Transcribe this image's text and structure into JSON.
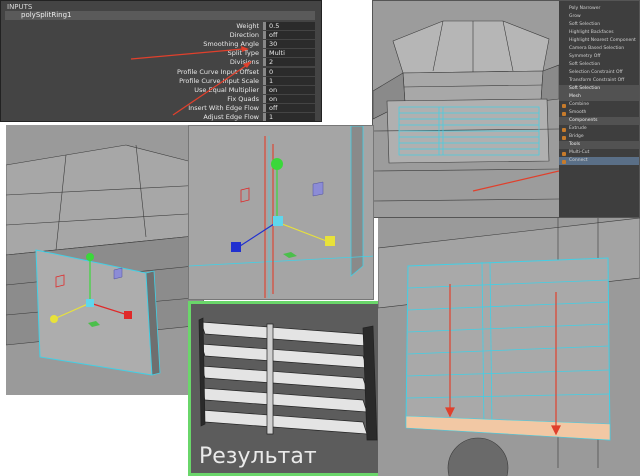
{
  "inputs_panel": {
    "header": "INPUTS",
    "node_name": "polySplitRing1",
    "rows": [
      {
        "label": "Weight",
        "value": "0.5"
      },
      {
        "label": "Direction",
        "value": "off"
      },
      {
        "label": "Smoothing Angle",
        "value": "30"
      },
      {
        "label": "Split Type",
        "value": "Multi"
      },
      {
        "label": "Divisions",
        "value": "2"
      },
      {
        "label": "Profile Curve Input Offset",
        "value": "0"
      },
      {
        "label": "Profile Curve Input Scale",
        "value": "1"
      },
      {
        "label": "Use Equal Multiplier",
        "value": "on"
      },
      {
        "label": "Fix Quads",
        "value": "on"
      },
      {
        "label": "Insert With Edge Flow",
        "value": "off"
      },
      {
        "label": "Adjust Edge Flow",
        "value": "1"
      }
    ]
  },
  "modeling_toolkit": {
    "options": [
      "Poly Narrower",
      "Grow",
      "Soft Selection",
      "Highlight Backfaces",
      "Highlight Nearest Component"
    ],
    "camera_row": "Camera Based Selection",
    "symmetry_row": {
      "label": "Symmetry",
      "value": "Off"
    },
    "soft_select_row": "Soft Selection",
    "selection_constraint": {
      "label": "Selection Constraint",
      "value": "Off"
    },
    "transform_constraint": {
      "label": "Transform Constraint",
      "value": "Off"
    },
    "sections": [
      {
        "title": "Soft Selection",
        "items": []
      },
      {
        "title": "Mesh",
        "items": [
          "Combine",
          "Smooth"
        ]
      },
      {
        "title": "Components",
        "items": [
          "Extrude",
          "Bridge"
        ]
      },
      {
        "title": "Tools",
        "items": [
          "Multi-Cut",
          "Connect"
        ]
      }
    ]
  },
  "result_caption": "Результат",
  "colors": {
    "result_frame": "#6ad66a",
    "wire": "#41d0e6",
    "arrow": "#e0402c",
    "viewport": "#9c9c9c",
    "highlight_face": "#f2c8a4"
  }
}
